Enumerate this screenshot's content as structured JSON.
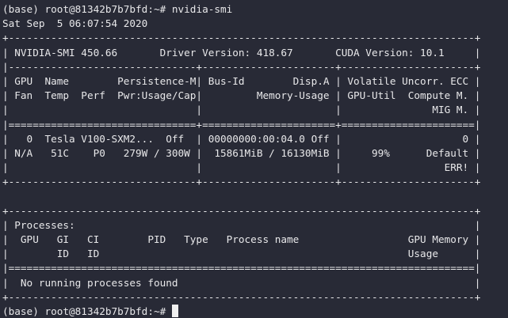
{
  "terminal": {
    "prompt": "(base) root@81342b7b7bfd:~# ",
    "command": "nvidia-smi",
    "output_lines": [
      "Sat Sep  5 06:07:54 2020",
      "+-----------------------------------------------------------------------------+",
      "| NVIDIA-SMI 450.66       Driver Version: 418.67       CUDA Version: 10.1     |",
      "|-------------------------------+----------------------+----------------------+",
      "| GPU  Name        Persistence-M| Bus-Id        Disp.A | Volatile Uncorr. ECC |",
      "| Fan  Temp  Perf  Pwr:Usage/Cap|         Memory-Usage | GPU-Util  Compute M. |",
      "|                               |                      |               MIG M. |",
      "|===============================+======================+======================|",
      "|   0  Tesla V100-SXM2...  Off  | 00000000:00:04.0 Off |                    0 |",
      "| N/A   51C    P0   279W / 300W |  15861MiB / 16130MiB |     99%      Default |",
      "|                               |                      |                 ERR! |",
      "+-------------------------------+----------------------+----------------------+",
      "",
      "+-----------------------------------------------------------------------------+",
      "| Processes:                                                                  |",
      "|  GPU   GI   CI        PID   Type   Process name                  GPU Memory |",
      "|        ID   ID                                                   Usage      |",
      "|=============================================================================|",
      "|  No running processes found                                                 |",
      "+-----------------------------------------------------------------------------+"
    ],
    "final_prompt": "(base) root@81342b7b7bfd:~# "
  }
}
